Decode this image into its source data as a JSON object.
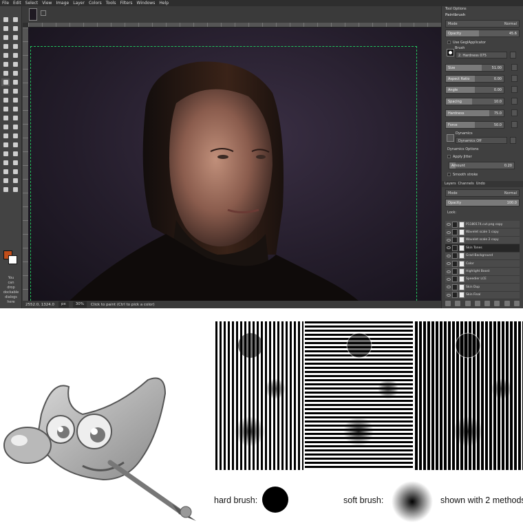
{
  "menubar": {
    "items": [
      "File",
      "Edit",
      "Select",
      "View",
      "Image",
      "Layer",
      "Colors",
      "Tools",
      "Filters",
      "Windows",
      "Help"
    ]
  },
  "toolbox": {
    "tools": [
      "rect-select",
      "free-select",
      "fuzzy-select",
      "move",
      "crop",
      "rotate",
      "scale",
      "flip",
      "cage",
      "warp",
      "text",
      "paintbucket",
      "blend",
      "pencil",
      "paintbrush",
      "eraser",
      "airbrush",
      "ink",
      "clone",
      "heal",
      "smudge",
      "dodge",
      "path",
      "color-picker",
      "zoom",
      "measure",
      "align",
      "perspective",
      "unified-transform",
      "handle-transform",
      "warp-transform",
      "foreground-select",
      "mypaint",
      "gegl",
      "levels",
      "curves",
      "threshold",
      "desaturate",
      "invert",
      "hue-saturation"
    ],
    "selected_tool": 14,
    "fg_color": "#c04e1b",
    "bg_color": "#ffffff",
    "drop_hint": "You\ncan\ndrop\ndockable\ndialogs\nhere"
  },
  "statusbar": {
    "coords": "2552.0, 1324.0",
    "unit": "px",
    "zoom": "30%",
    "message": "Click to paint (Ctrl to pick a color)"
  },
  "tool_options": {
    "tab": "Tool Options",
    "title": "Paintbrush",
    "mode_label": "Mode",
    "mode_value": "Normal",
    "opacity_label": "Opacity",
    "opacity_value": "45.6",
    "opacity_level": 0.456,
    "use_gegl": "Use GeglApplicator",
    "brush_label": "Brush",
    "brush_value": "2. Hardness 075",
    "size_label": "Size",
    "size_value": "51.00",
    "size_level": 0.62,
    "aspect_label": "Aspect Ratio",
    "aspect_value": "0.00",
    "aspect_level": 0.5,
    "angle_label": "Angle",
    "angle_value": "0.00",
    "angle_level": 0.5,
    "spacing_label": "Spacing",
    "spacing_value": "10.0",
    "spacing_level": 0.45,
    "hardness_label": "Hardness",
    "hardness_value": "75.0",
    "hardness_level": 0.75,
    "force_label": "Force",
    "force_value": "50.0",
    "force_level": 0.5,
    "dynamics_label": "Dynamics",
    "dynamics_value": "Dynamics Off",
    "dynamics_options": "Dynamics Options",
    "apply_jitter": "Apply Jitter",
    "amount_label": "Amount",
    "amount_value": "0.20",
    "amount_level": 0.1,
    "smooth_stroke": "Smooth stroke"
  },
  "layers": {
    "tabs": [
      "Layers",
      "Channels",
      "Undo"
    ],
    "mode_label": "Mode",
    "mode_value": "Normal",
    "opacity_label": "Opacity",
    "opacity_value": "100.0",
    "opacity_level": 1.0,
    "lock_label": "Lock:",
    "items": [
      "P1180174.cut.png copy",
      "Wavelet scale 1 copy",
      "Wavelet scale 2 copy",
      "Skin Tones",
      "Grad Background",
      "Color",
      "Highlight Boost",
      "Speedier LCE",
      "Skin Dup",
      "Skin Final"
    ],
    "selected_index": 3
  },
  "illustration": {
    "hard_label": "hard brush:",
    "soft_label": "soft brush:",
    "methods_label": "shown with 2 methods"
  }
}
